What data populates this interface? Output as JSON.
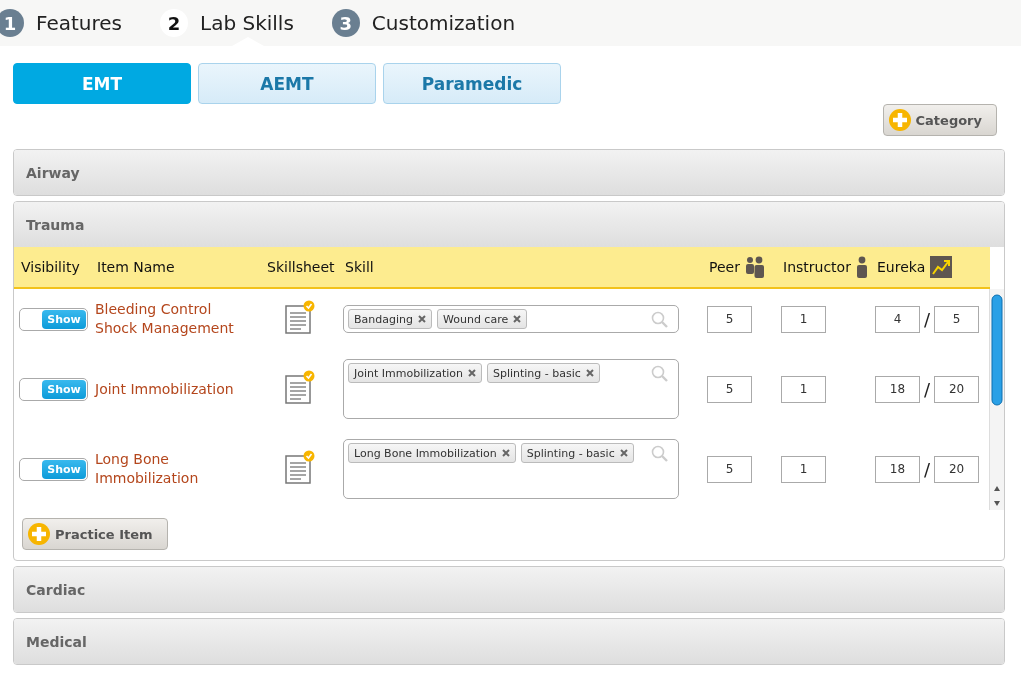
{
  "steps": [
    {
      "number": "1",
      "label": "Features",
      "selected": false
    },
    {
      "number": "2",
      "label": "Lab Skills",
      "selected": true
    },
    {
      "number": "3",
      "label": "Customization",
      "selected": false
    }
  ],
  "level_tabs": [
    {
      "label": "EMT",
      "selected": true
    },
    {
      "label": "AEMT",
      "selected": false
    },
    {
      "label": "Paramedic",
      "selected": false
    }
  ],
  "add_category_button": "Category",
  "sections": [
    {
      "title": "Airway"
    },
    {
      "title": "Trauma",
      "table": {
        "columns": [
          "Visibility",
          "Item Name",
          "Skillsheet",
          "Skill",
          "Peer",
          "Instructor",
          "Eureka"
        ],
        "rows": [
          {
            "visibility": "Show",
            "shown": true,
            "name": "Bleeding Control Shock Management",
            "skills": [
              "Bandaging",
              "Wound care"
            ],
            "peer": "5",
            "instructor": "1",
            "eureka_score": "4",
            "eureka_separator": "/",
            "eureka_total": "5"
          },
          {
            "visibility": "Show",
            "shown": true,
            "name": "Joint Immobilization",
            "skills": [
              "Joint Immobilization",
              "Splinting - basic"
            ],
            "peer": "5",
            "instructor": "1",
            "eureka_score": "18",
            "eureka_separator": "/",
            "eureka_total": "20"
          },
          {
            "visibility": "Show",
            "shown": true,
            "name": "Long Bone Immobilization",
            "skills": [
              "Long Bone Immobilization",
              "Splinting - basic"
            ],
            "peer": "5",
            "instructor": "1",
            "eureka_score": "18",
            "eureka_separator": "/",
            "eureka_total": "20"
          }
        ]
      },
      "add_item_button": "Practice Item"
    },
    {
      "title": "Cardiac"
    },
    {
      "title": "Medical"
    }
  ]
}
